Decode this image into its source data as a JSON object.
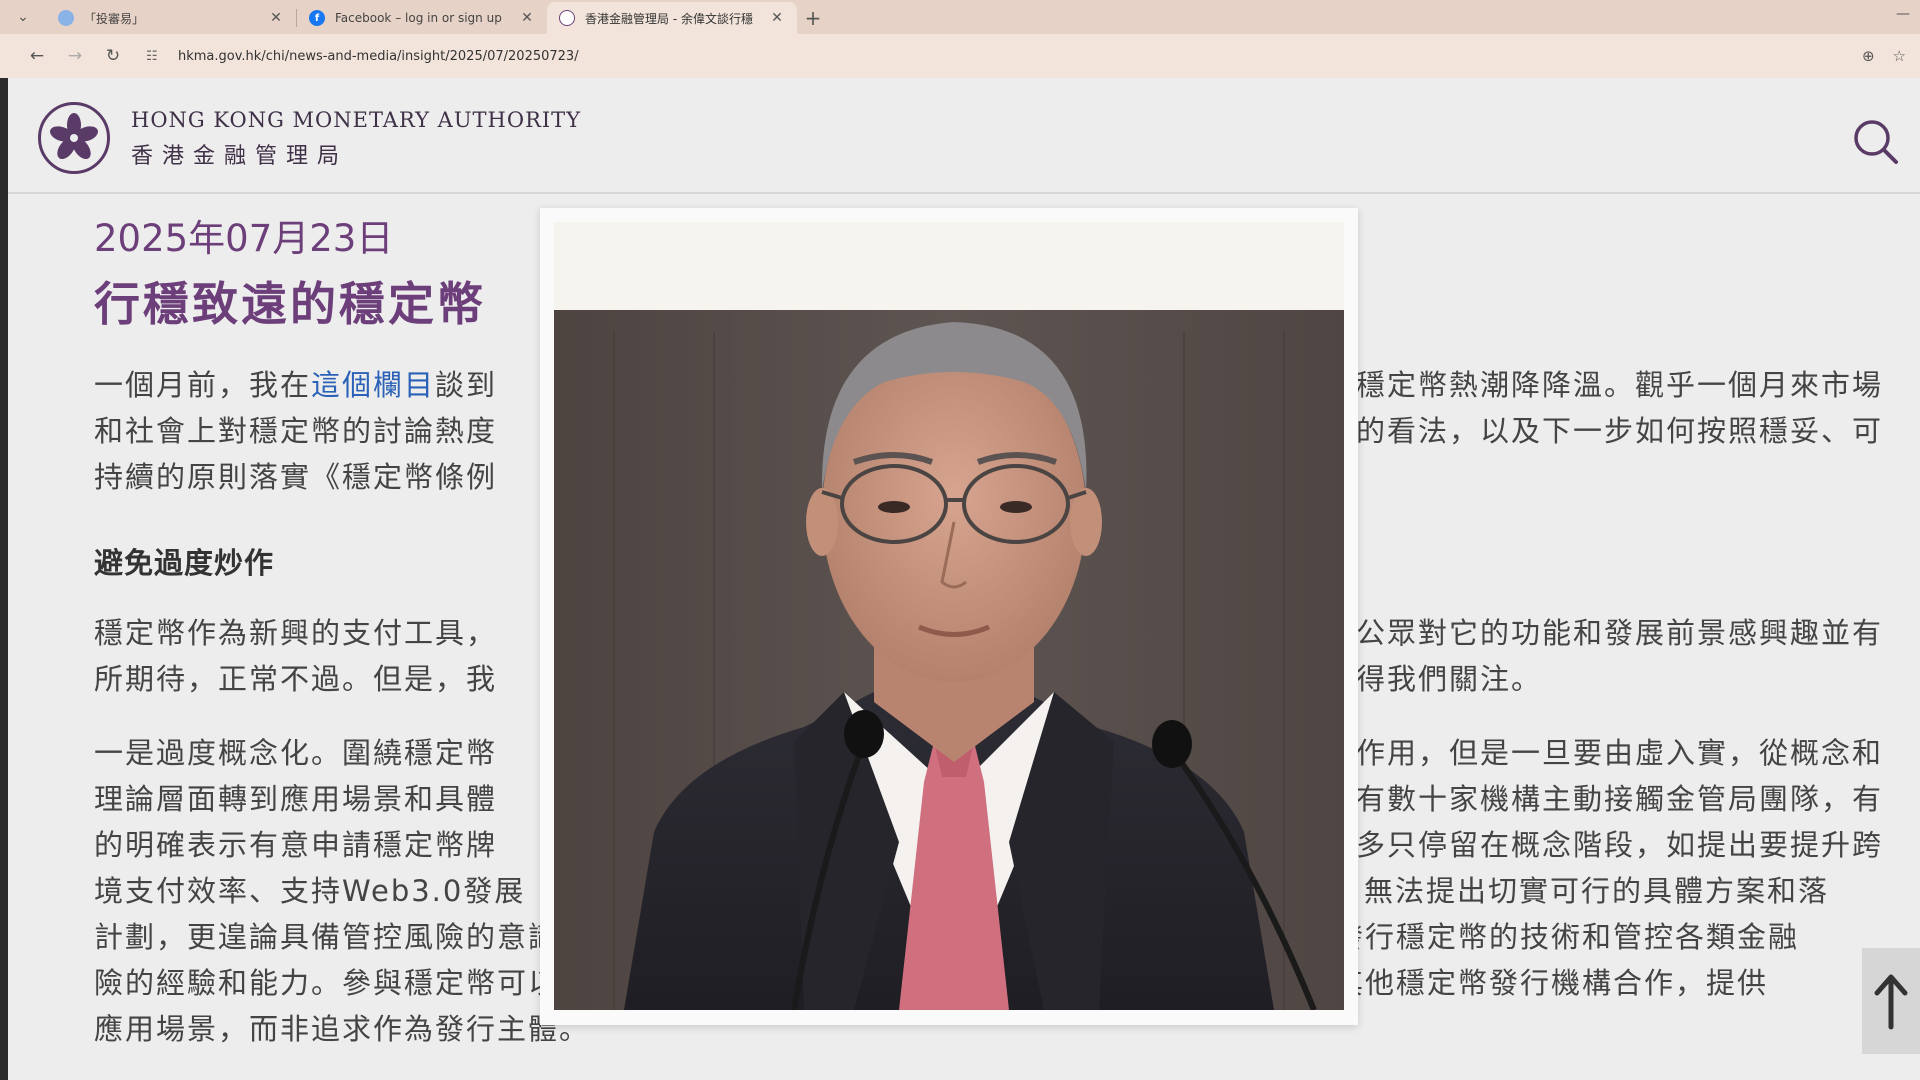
{
  "browser": {
    "tabs": [
      {
        "title": "「投審易」",
        "favicon": "site-icon",
        "active": false
      },
      {
        "title": "Facebook – log in or sign up",
        "favicon": "facebook-icon",
        "active": false
      },
      {
        "title": "香港金融管理局 - 余偉文談行穩",
        "favicon": "hkma-icon",
        "active": true
      }
    ],
    "new_tab": "+",
    "url": "hkma.gov.hk/chi/news-and-media/insight/2025/07/20250723/"
  },
  "header": {
    "name_en": "HONG KONG MONETARY AUTHORITY",
    "name_zh": "香港金融管理局",
    "brand_color": "#6d3f7a"
  },
  "article": {
    "date": "2025年07月23日",
    "title": "行穩致遠的穩定幣",
    "p1": {
      "l1a": "一個月前，我在",
      "l1link": "這個欄目",
      "l1b": "談到",
      "l1c": "穩定幣熱潮降降溫。觀乎一個月來市場",
      "l2a": "和社會上對穩定幣的討論熱度",
      "l2b": "的看法，以及下一步如何按照穩妥、可",
      "l3a": "持續的原則落實《穩定幣條例"
    },
    "subhead": "避免過度炒作",
    "p2": {
      "l1a": "穩定幣作為新興的支付工具，",
      "l1b": "公眾對它的功能和發展前景感興趣並有",
      "l2a": "所期待，正常不過。但是，我",
      "l2b": "得我們關注。"
    },
    "p3": {
      "l1a": "一是過度概念化。圍繞穩定幣",
      "l1b": "作用，但是一旦要由虛入實，從概念和",
      "l2a": "理論層面轉到應用場景和具體",
      "l2b": "有數十家機構主動接觸金管局團隊，有",
      "l3a": "的明確表示有意申請穩定幣牌",
      "l3b": "多只停留在概念階段，如提出要提升跨",
      "l4a": "境支付效率、支持Web3.0發展",
      "l4b": "無法提出切實可行的具體方案和落",
      "l5a": "計劃，更遑論具備管控風險的意識和能力",
      "l5b": "部分能提供應用場景的，機構本身卻缺乏發行穩定幣的技術和管控各類金融",
      "l6": "險的經驗和能力。參與穩定幣可以有多種模式，對於這類機構而言，較實際的做法似乎是與其他穩定幣發行機構合作，提供",
      "l7": "應用場景，而非追求作為發行主體。"
    }
  }
}
